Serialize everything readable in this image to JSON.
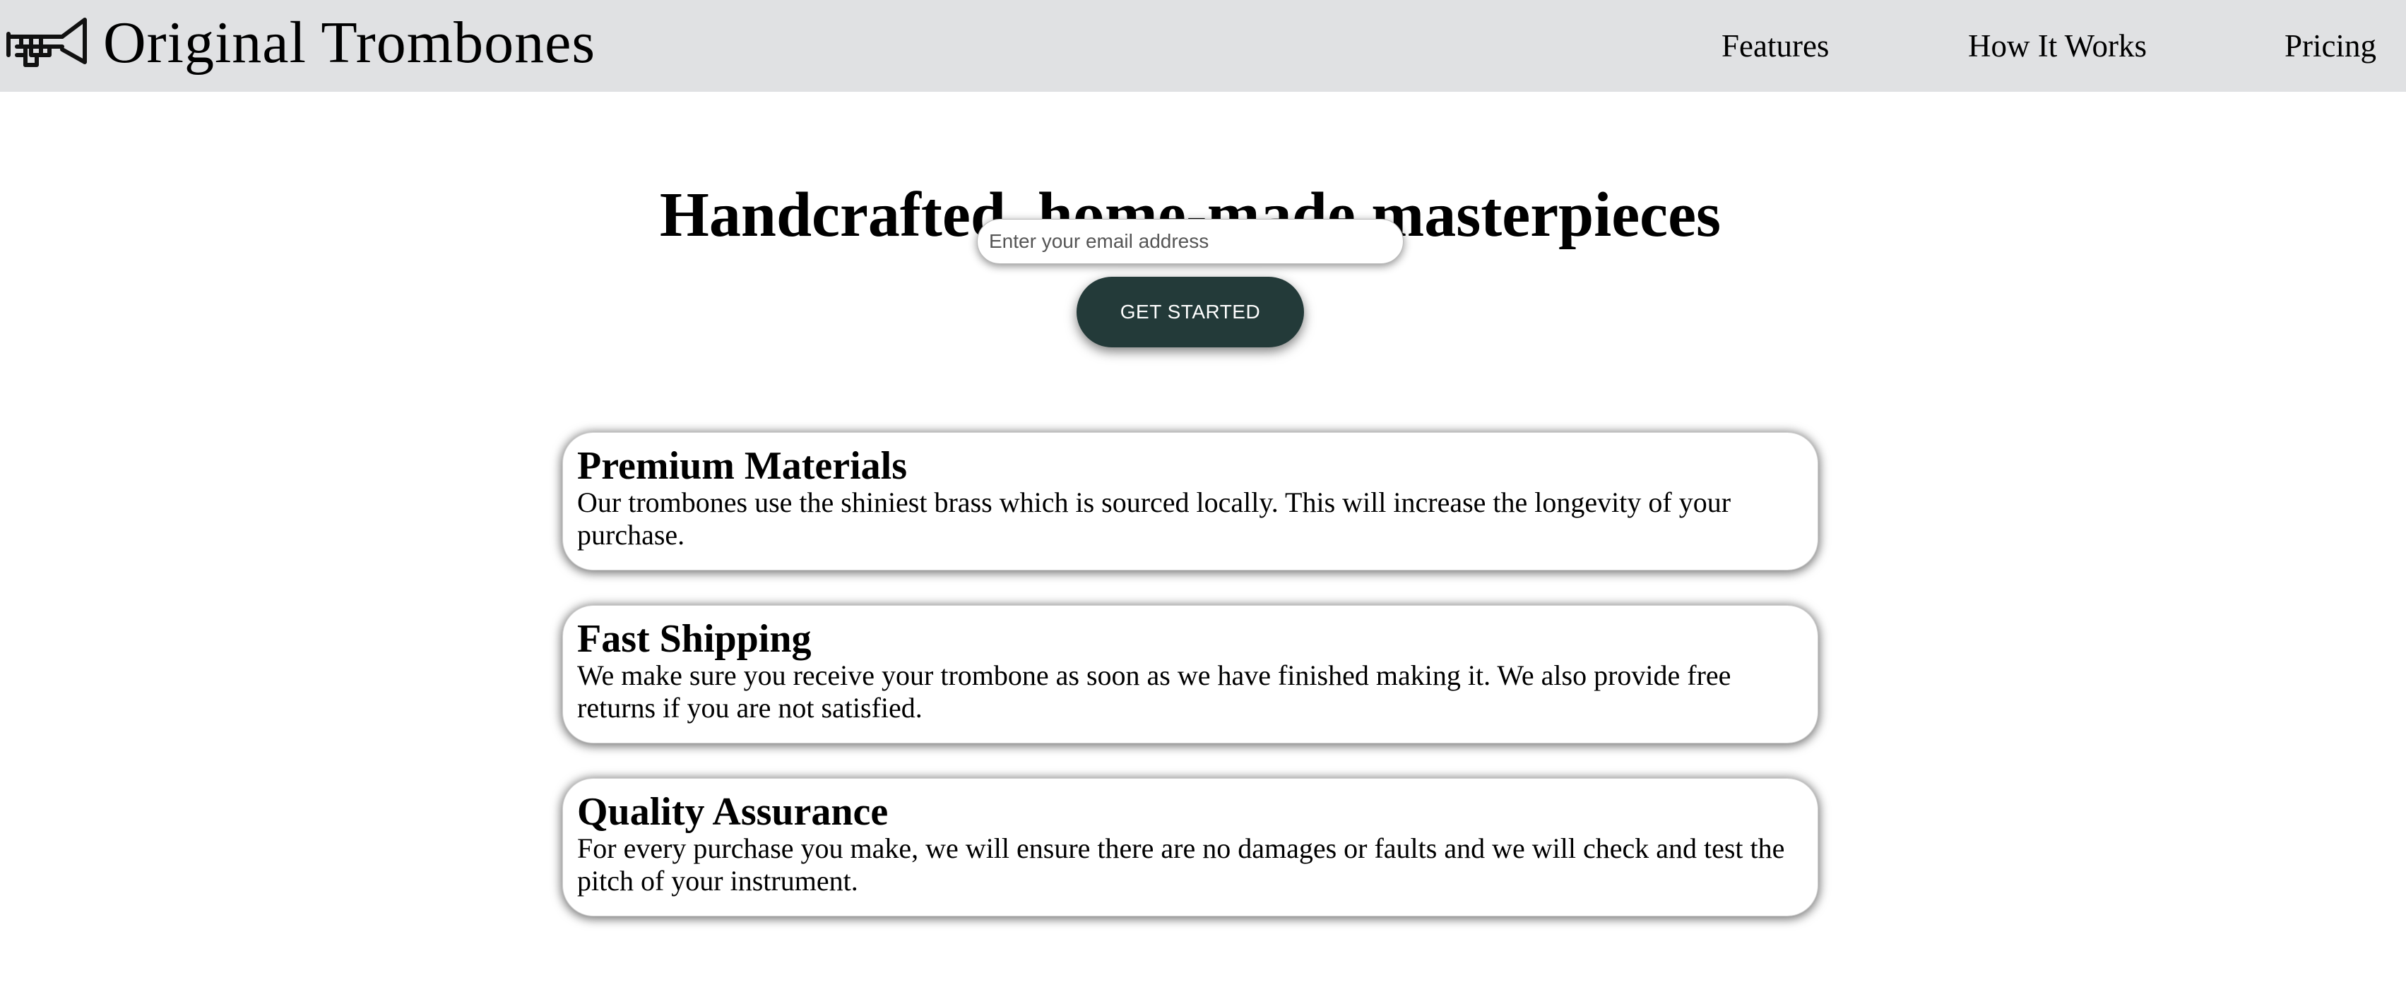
{
  "header": {
    "logo_icon": "trombone-icon",
    "brand": "Original Trombones",
    "background": "#e0e1e3",
    "nav": [
      {
        "label": "Features"
      },
      {
        "label": "How It Works"
      },
      {
        "label": "Pricing"
      }
    ]
  },
  "hero": {
    "title": "Handcrafted, home-made masterpieces",
    "email_placeholder": "Enter your email address",
    "email_value": "",
    "cta_label": "GET STARTED",
    "cta_color": "#233a39"
  },
  "features": [
    {
      "title": "Premium Materials",
      "text": "Our trombones use the shiniest brass which is sourced locally. This will increase the longevity of your purchase."
    },
    {
      "title": "Fast Shipping",
      "text": "We make sure you receive your trombone as soon as we have finished making it. We also provide free returns if you are not satisfied."
    },
    {
      "title": "Quality Assurance",
      "text": "For every purchase you make, we will ensure there are no damages or faults and we will check and test the pitch of your instrument."
    }
  ]
}
